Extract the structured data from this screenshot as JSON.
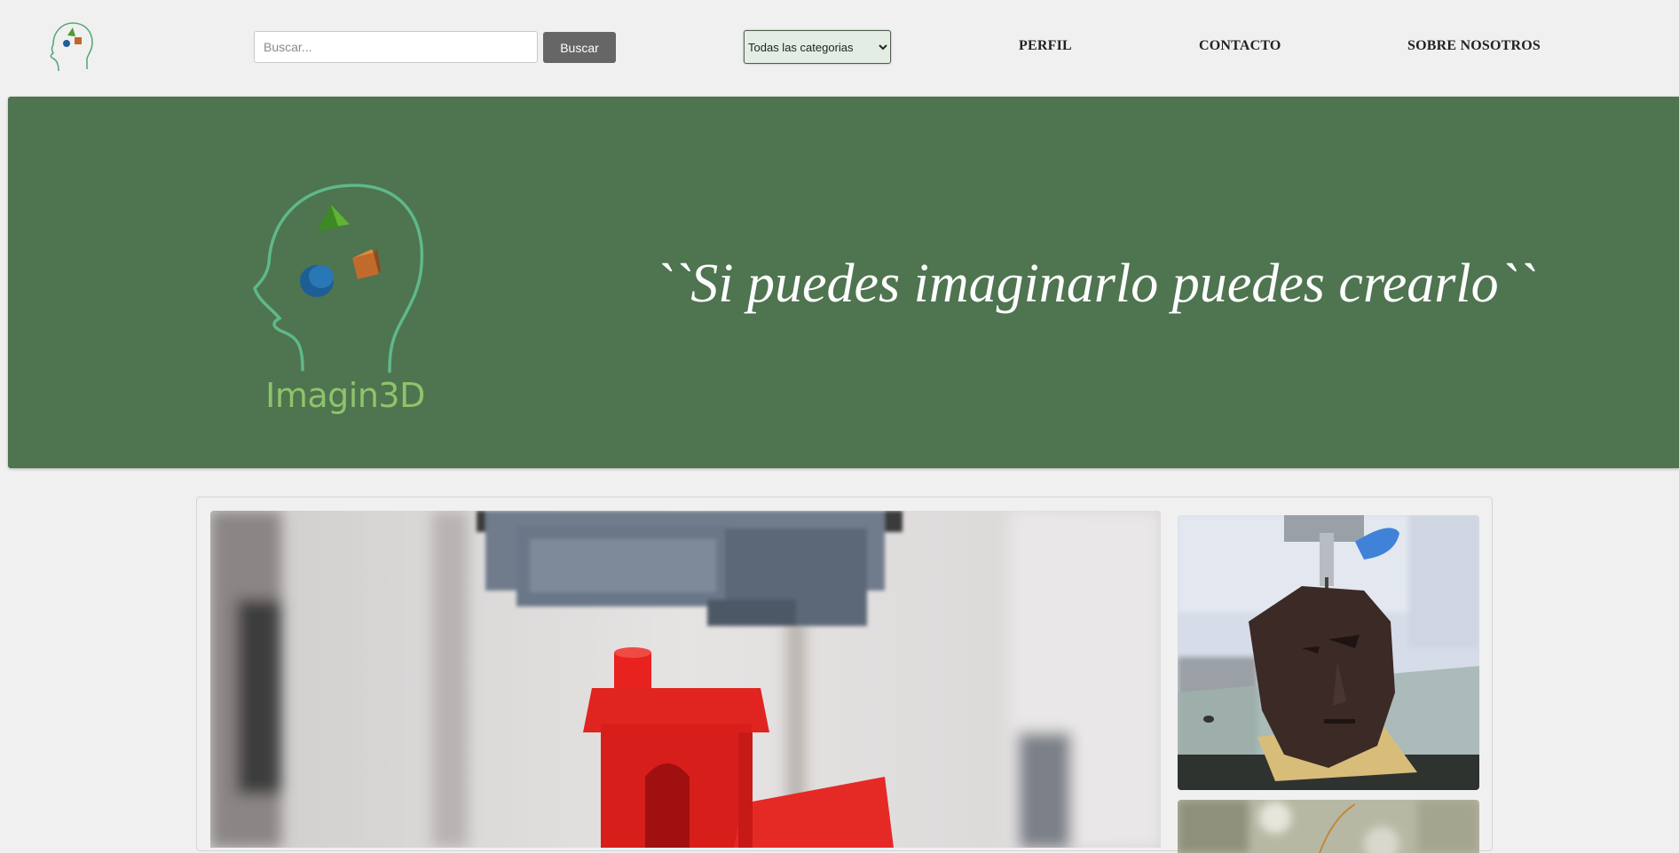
{
  "header": {
    "logo_icon": "brain-head-logo-icon",
    "search": {
      "placeholder": "Buscar...",
      "value": "",
      "button_label": "Buscar"
    },
    "category_select": {
      "selected": "Todas las categorias"
    },
    "nav": {
      "perfil": "PERFIL",
      "contacto": "CONTACTO",
      "sobre": "SOBRE NOSOTROS"
    }
  },
  "hero": {
    "brand": "Imagin3D",
    "slogan": "``Si puedes imaginarlo puedes crearlo``",
    "background_color": "#4e7450",
    "brand_color": "#8ec36b"
  },
  "gallery": {
    "main_image": "3d-printer-red-benchy-photo",
    "side_images": [
      "3d-printed-chocolate-head-photo",
      "3d-printing-outdoor-photo"
    ]
  }
}
